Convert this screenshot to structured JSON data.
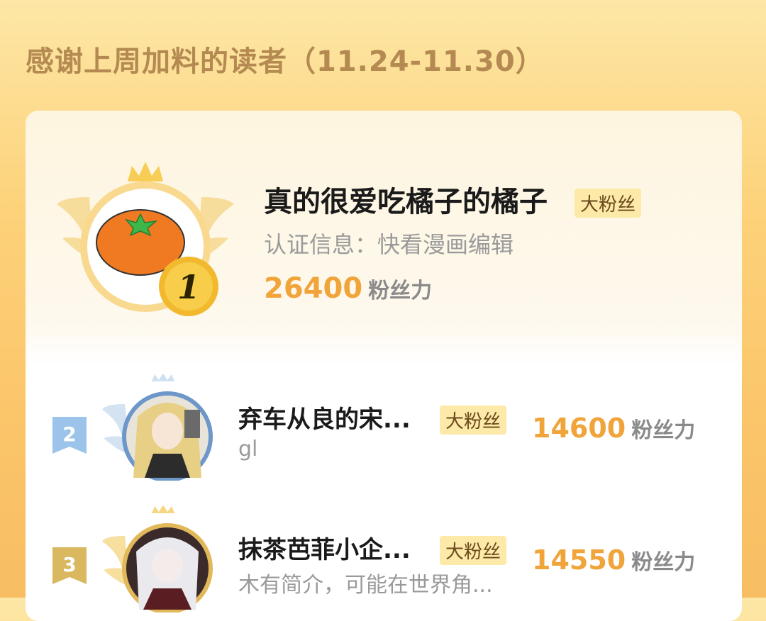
{
  "heading": "感谢上周加料的读者（11.24-11.30）",
  "top": {
    "rank": "1",
    "name": "真的很爱吃橘子的橘子",
    "tag": "大粉丝",
    "description": "认证信息：快看漫画编辑",
    "score": "26400",
    "score_unit": "粉丝力",
    "avatar": "orange-icon"
  },
  "rows": [
    {
      "rank": "2",
      "name": "弃车从良的宋...",
      "tag": "大粉丝",
      "description": "gl",
      "score": "14600",
      "score_unit": "粉丝力",
      "badge_color": "#9cc4ea"
    },
    {
      "rank": "3",
      "name": "抹茶芭菲小企...",
      "tag": "大粉丝",
      "description": "木有简介，可能在世界角...",
      "score": "14550",
      "score_unit": "粉丝力",
      "badge_color": "#e7c25e"
    }
  ],
  "colors": {
    "accent": "#f0a43a",
    "tag_bg": "#fde9a8",
    "heading": "#b48a52"
  }
}
